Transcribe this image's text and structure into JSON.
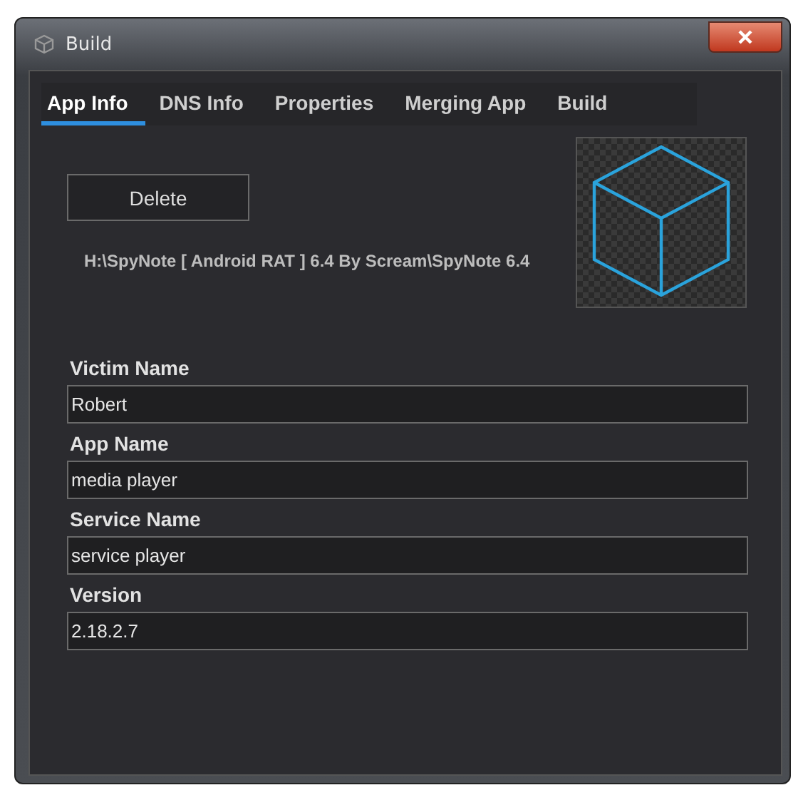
{
  "window": {
    "title": "Build"
  },
  "tabs": [
    {
      "label": "App Info",
      "selected": true
    },
    {
      "label": "DNS Info",
      "selected": false
    },
    {
      "label": "Properties",
      "selected": false
    },
    {
      "label": "Merging App",
      "selected": false
    },
    {
      "label": "Build",
      "selected": false
    }
  ],
  "delete_button": "Delete",
  "path": "H:\\SpyNote [ Android RAT ] 6.4 By Scream\\SpyNote 6.4",
  "fields": [
    {
      "label": "Victim Name",
      "value": "Robert"
    },
    {
      "label": "App Name",
      "value": "media player"
    },
    {
      "label": "Service Name",
      "value": "service player"
    },
    {
      "label": "Version",
      "value": "2.18.2.7"
    }
  ]
}
